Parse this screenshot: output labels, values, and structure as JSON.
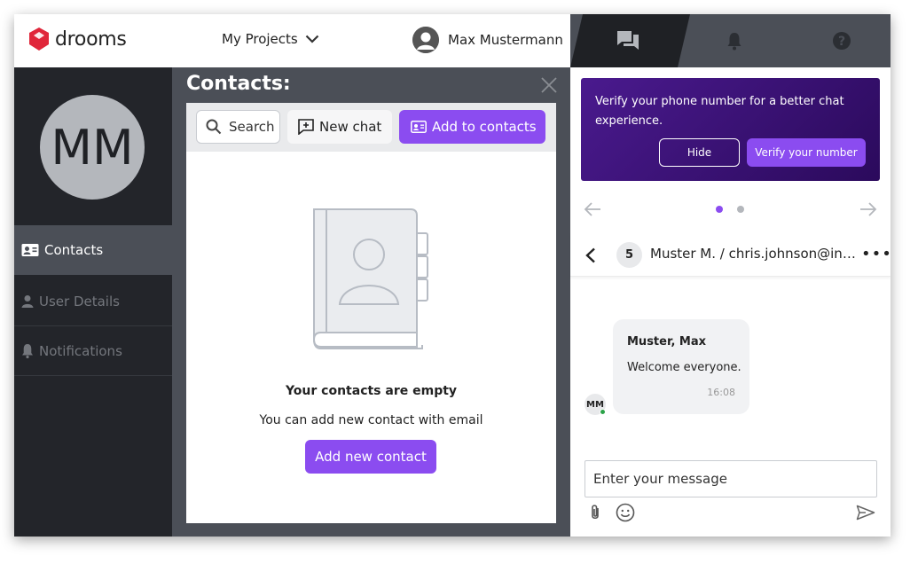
{
  "app": {
    "brand": "drooms",
    "brand_color": "#e0263a",
    "accent": "#8b4cf0"
  },
  "topbar": {
    "projects_label": "My Projects",
    "user_name": "Max Mustermann"
  },
  "tabs": [
    {
      "icon": "chat-icon",
      "active": true
    },
    {
      "icon": "bell-icon",
      "active": false
    },
    {
      "icon": "help-icon",
      "active": false
    }
  ],
  "leftnav": {
    "avatar_initials": "MM",
    "items": [
      {
        "label": "Contacts",
        "icon": "contacts-card-icon",
        "active": true
      },
      {
        "label": "User Details",
        "icon": "user-icon",
        "active": false
      },
      {
        "label": "Notifications",
        "icon": "bell-icon",
        "active": false
      }
    ]
  },
  "contacts": {
    "title": "Contacts:",
    "search_placeholder": "Search",
    "new_chat_label": "New chat",
    "add_to_contacts_label": "Add to contacts",
    "empty_title": "Your contacts are empty",
    "empty_subtitle": "You can add new contact with email",
    "add_new_label": "Add new contact"
  },
  "chat": {
    "banner": {
      "text": "Verify your phone number for a better chat experience.",
      "hide_label": "Hide",
      "verify_label": "Verify your number"
    },
    "carousel": {
      "pages": 2,
      "current": 1
    },
    "conversation": {
      "participant_count": "5",
      "title": "Muster M. / chris.johnson@inbox.com",
      "more": "•••"
    },
    "messages": [
      {
        "sender": "Muster, Max",
        "text": "Welcome everyone.",
        "time": "16:08",
        "avatar": "MM",
        "online": true
      }
    ],
    "input_placeholder": "Enter your message"
  }
}
